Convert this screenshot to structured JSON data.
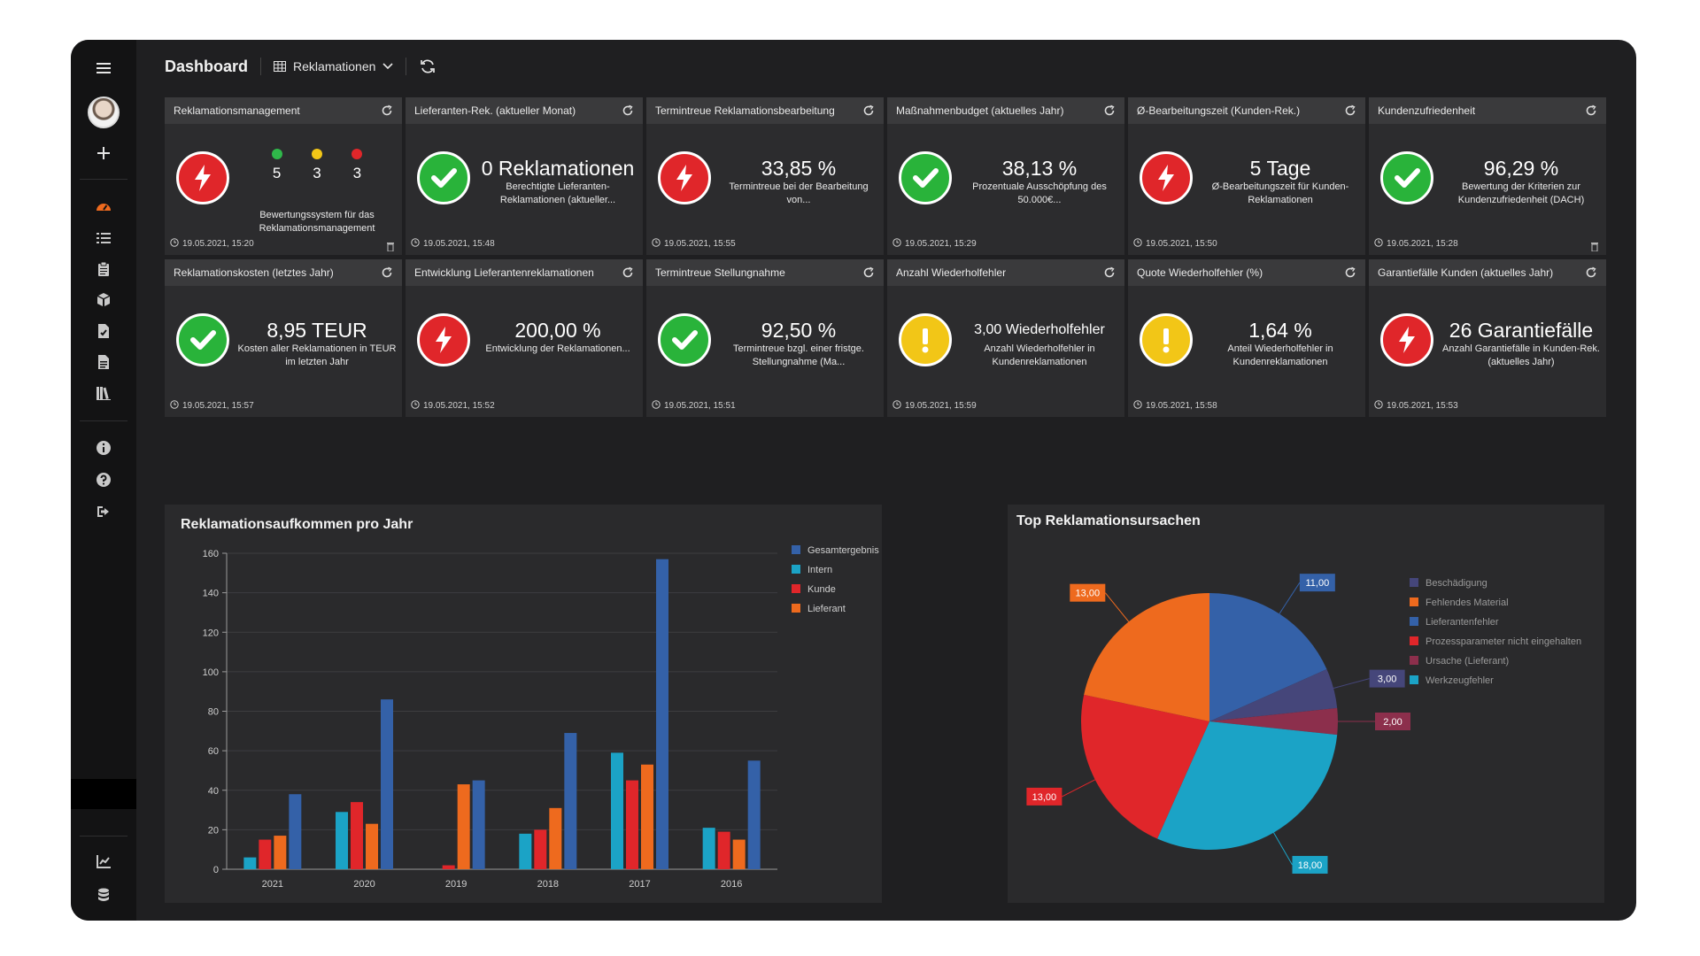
{
  "topbar": {
    "title": "Dashboard",
    "dropdown_label": "Reklamationen"
  },
  "sidebar": {
    "items": [
      "menu-icon",
      "avatar",
      "plus-icon",
      "dashboard-icon",
      "list-icon",
      "clipboard-icon",
      "cubes-icon",
      "file-icon",
      "document-icon",
      "library-icon",
      "info-icon",
      "help-icon",
      "logout-icon",
      "chart-icon",
      "database-icon"
    ]
  },
  "kpis": [
    {
      "title": "Reklamationsmanagement",
      "type": "dots",
      "status": "red",
      "dots": [
        {
          "color": "#2fb84a",
          "value": "5"
        },
        {
          "color": "#f2c617",
          "value": "3"
        },
        {
          "color": "#e0262a",
          "value": "3"
        }
      ],
      "desc": "Bewertungssystem für das Reklamationsmanagement",
      "time": "19.05.2021, 15:20",
      "trash": true
    },
    {
      "title": "Lieferanten-Rek. (aktueller Monat)",
      "status": "green",
      "value": "0 Reklamationen",
      "desc": "Berechtigte Lieferanten-Reklamationen (aktueller...",
      "time": "19.05.2021, 15:48"
    },
    {
      "title": "Termintreue Reklamationsbearbeitung",
      "status": "red",
      "value": "33,85 %",
      "desc": "Termintreue bei der Bearbeitung von...",
      "time": "19.05.2021, 15:55"
    },
    {
      "title": "Maßnahmenbudget (aktuelles Jahr)",
      "status": "green",
      "value": "38,13 %",
      "desc": "Prozentuale Ausschöpfung des 50.000€...",
      "time": "19.05.2021, 15:29"
    },
    {
      "title": "Ø-Bearbeitungszeit (Kunden-Rek.)",
      "status": "red",
      "value": "5 Tage",
      "desc": "Ø-Bearbeitungszeit für Kunden-Reklamationen",
      "time": "19.05.2021, 15:50"
    },
    {
      "title": "Kundenzufriedenheit",
      "status": "green",
      "value": "96,29 %",
      "desc": "Bewertung der Kriterien zur Kundenzufriedenheit (DACH)",
      "time": "19.05.2021, 15:28",
      "trash": true
    },
    {
      "title": "Reklamationskosten (letztes Jahr)",
      "status": "green",
      "value": "8,95 TEUR",
      "desc": "Kosten aller Reklamationen in TEUR im letzten Jahr",
      "time": "19.05.2021, 15:57"
    },
    {
      "title": "Entwicklung Lieferantenreklamationen",
      "status": "red",
      "value": "200,00 %",
      "desc": "Entwicklung der Reklamationen...",
      "time": "19.05.2021, 15:52"
    },
    {
      "title": "Termintreue Stellungnahme",
      "status": "green",
      "value": "92,50 %",
      "desc": "Termintreue bzgl. einer fristge. Stellungnahme (Ma...",
      "time": "19.05.2021, 15:51"
    },
    {
      "title": "Anzahl Wiederholfehler",
      "status": "yellow",
      "value": "3,00 Wiederholfehler",
      "value_small": true,
      "desc": "Anzahl Wiederholfehler in Kundenreklamationen",
      "time": "19.05.2021, 15:59"
    },
    {
      "title": "Quote Wiederholfehler (%)",
      "status": "yellow",
      "value": "1,64 %",
      "desc": "Anteil Wiederholfehler in Kundenreklamationen",
      "time": "19.05.2021, 15:58"
    },
    {
      "title": "Garantiefälle Kunden (aktuelles Jahr)",
      "status": "red",
      "value": "26 Garantiefälle",
      "desc": "Anzahl Garantiefälle in Kunden-Rek. (aktuelles Jahr)",
      "time": "19.05.2021, 15:53"
    }
  ],
  "chart_data": [
    {
      "type": "bar",
      "title": "Reklamationsaufkommen pro Jahr",
      "categories": [
        "2021",
        "2020",
        "2019",
        "2018",
        "2017",
        "2016"
      ],
      "ylim": [
        0,
        160
      ],
      "yticks": [
        0,
        20,
        40,
        60,
        80,
        100,
        120,
        140,
        160
      ],
      "grid": true,
      "legend_position": "right",
      "series": [
        {
          "name": "Intern",
          "color": "#1ba3c6",
          "values": [
            6,
            29,
            0,
            18,
            59,
            21
          ]
        },
        {
          "name": "Kunde",
          "color": "#e0262a",
          "values": [
            15,
            34,
            2,
            20,
            45,
            19
          ]
        },
        {
          "name": "Lieferant",
          "color": "#ee6a1e",
          "values": [
            17,
            23,
            43,
            31,
            53,
            15
          ]
        },
        {
          "name": "Gesamtergebnis",
          "color": "#3461a8",
          "values": [
            38,
            86,
            45,
            69,
            157,
            55
          ]
        }
      ],
      "legend_order": [
        "Gesamtergebnis",
        "Intern",
        "Kunde",
        "Lieferant"
      ]
    },
    {
      "type": "pie",
      "title": "Top Reklamationsursachen",
      "legend_position": "right",
      "slices": [
        {
          "name": "Lieferantenfehler",
          "value": 11,
          "label": "11,00",
          "color": "#3461a8"
        },
        {
          "name": "Beschädigung",
          "value": 3,
          "label": "3,00",
          "color": "#45467a"
        },
        {
          "name": "Ursache (Lieferant)",
          "value": 2,
          "label": "2,00",
          "color": "#8c2f4c"
        },
        {
          "name": "Werkzeugfehler",
          "value": 18,
          "label": "18,00",
          "color": "#1ba3c6"
        },
        {
          "name": "Prozessparameter nicht eingehalten",
          "value": 13,
          "label": "13,00",
          "color": "#e0262a"
        },
        {
          "name": "Fehlendes Material",
          "value": 13,
          "label": "13,00",
          "color": "#ee6a1e"
        }
      ],
      "legend_order": [
        "Beschädigung",
        "Fehlendes Material",
        "Lieferantenfehler",
        "Prozessparameter nicht eingehalten",
        "Ursache (Lieferant)",
        "Werkzeugfehler"
      ]
    }
  ]
}
